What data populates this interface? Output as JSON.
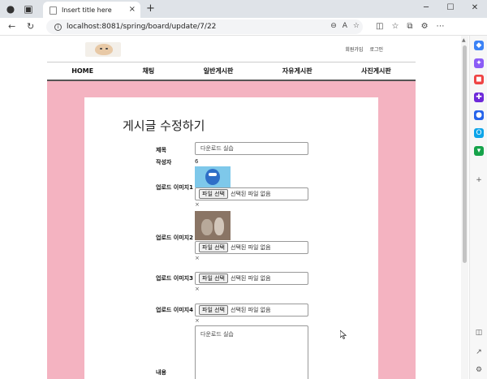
{
  "browser": {
    "tab_title": "Insert title here",
    "url": "localhost:8081/spring/board/update/7/22",
    "new_tab_glyph": "+",
    "close_glyph": "×"
  },
  "site": {
    "auth_links": [
      "회원가입",
      "로그인"
    ],
    "nav_items": [
      "HOME",
      "채팅",
      "일반게시판",
      "자유게시판",
      "사진게시판"
    ]
  },
  "form": {
    "title": "게시글 수정하기",
    "title_label": "제목",
    "title_value": "다운로드 실습",
    "author_label": "작성자",
    "author_value": "6",
    "images": [
      {
        "label": "업로드 이미지1",
        "button": "파일 선택",
        "status": "선택된 파일 없음",
        "remove": "×"
      },
      {
        "label": "업로드 이미지2",
        "button": "파일 선택",
        "status": "선택된 파일 없음",
        "remove": "×"
      },
      {
        "label": "업로드 이미지3",
        "button": "파일 선택",
        "status": "선택된 파일 없음",
        "remove": "×"
      },
      {
        "label": "업로드 이미지4",
        "button": "파일 선택",
        "status": "선택된 파일 없음",
        "remove": "×"
      }
    ],
    "content_label": "내용",
    "content_value": "다운로드 실습"
  },
  "colors": {
    "pink_background": "#f4b3c1",
    "browser_chrome": "#dfe3e8"
  },
  "icons": {
    "back": "back-arrow-icon",
    "refresh": "refresh-icon",
    "info": "site-info-icon",
    "zoom": "zoom-icon",
    "read_aloud": "read-aloud-icon",
    "favorite": "favorite-star-icon"
  }
}
